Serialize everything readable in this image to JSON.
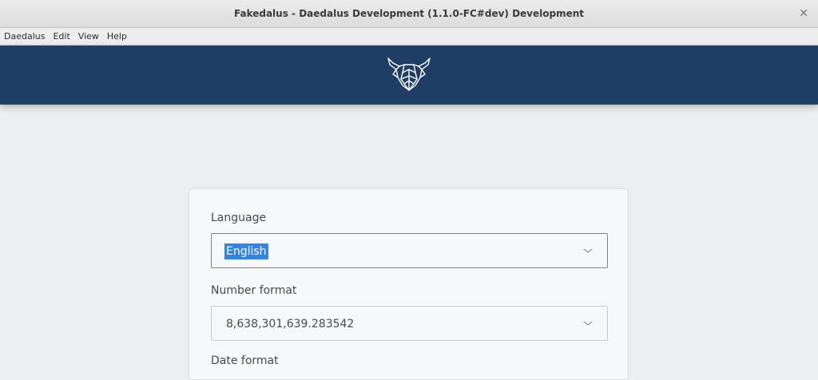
{
  "window": {
    "title": "Fakedalus - Daedalus Development (1.1.0-FC#dev) Development",
    "close_glyph": "✕"
  },
  "menu": {
    "items": [
      "Daedalus",
      "Edit",
      "View",
      "Help"
    ]
  },
  "header": {
    "logo_icon": "daedalus-logo-icon",
    "background": "#1e3f63"
  },
  "settings": {
    "language": {
      "label": "Language",
      "value": "English"
    },
    "number_format": {
      "label": "Number format",
      "value": "8,638,301,639.283542"
    },
    "date_format": {
      "label": "Date format"
    }
  },
  "colors": {
    "accent": "#3584e4",
    "header": "#1e3f63"
  }
}
